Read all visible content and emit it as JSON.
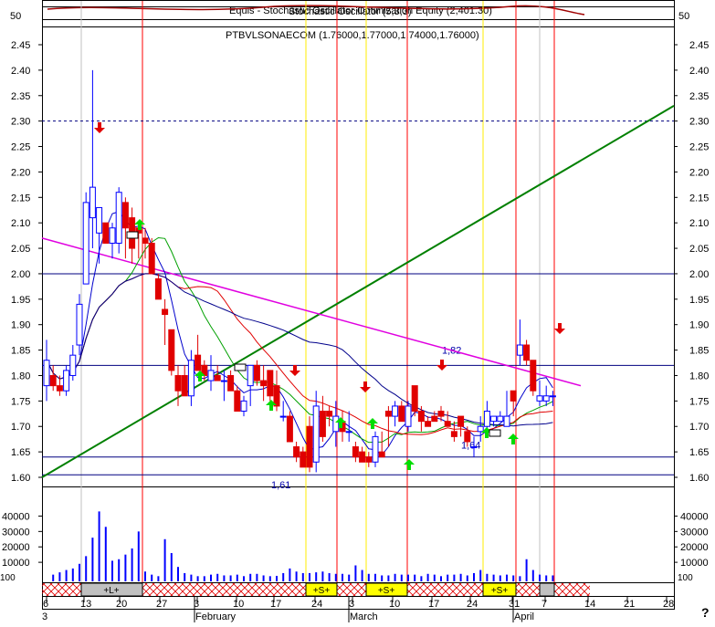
{
  "chart_data": {
    "type": "candlestick",
    "header": {
      "title": "Equis - Stochastic Oscillator Optimization Equity (2,401.30)",
      "overlap_text": "Stochastic Oscillator (5,3,3)",
      "subtitle": "PTBVLSONAECOM (1.76000,1.77000,1.74000,1.76000)",
      "tick_left": "50",
      "tick_right": "50"
    },
    "price_axis": {
      "ylim": [
        1.6,
        2.45
      ],
      "ticks": [
        "1.60",
        "1.65",
        "1.70",
        "1.75",
        "1.80",
        "1.85",
        "1.90",
        "1.95",
        "2.00",
        "2.05",
        "2.10",
        "2.15",
        "2.20",
        "2.25",
        "2.30",
        "2.35",
        "2.40",
        "2.45"
      ]
    },
    "volume_axis": {
      "ylim": [
        0,
        45000
      ],
      "ticks": [
        "10000",
        "20000",
        "30000",
        "40000"
      ],
      "bottom_label": "100"
    },
    "x_axis": {
      "ticks": [
        "6",
        "13",
        "20",
        "27",
        "3",
        "10",
        "17",
        "24",
        "3",
        "10",
        "17",
        "24",
        "31",
        "7",
        "14",
        "21",
        "28"
      ],
      "months": [
        "February",
        "March",
        "April"
      ],
      "first_label": "3"
    },
    "candles": [
      {
        "o": 1.78,
        "h": 1.87,
        "l": 1.75,
        "c": 1.83
      },
      {
        "o": 1.8,
        "h": 1.82,
        "l": 1.77,
        "c": 1.78
      },
      {
        "o": 1.78,
        "h": 1.8,
        "l": 1.76,
        "c": 1.77
      },
      {
        "o": 1.77,
        "h": 1.82,
        "l": 1.76,
        "c": 1.81
      },
      {
        "o": 1.8,
        "h": 1.86,
        "l": 1.79,
        "c": 1.84
      },
      {
        "o": 1.86,
        "h": 1.96,
        "l": 1.84,
        "c": 1.94
      },
      {
        "o": 1.98,
        "h": 2.16,
        "l": 1.98,
        "c": 2.14
      },
      {
        "o": 2.11,
        "h": 2.4,
        "l": 2.05,
        "c": 2.17
      },
      {
        "o": 2.08,
        "h": 2.1,
        "l": 2.02,
        "c": 2.13
      },
      {
        "o": 2.1,
        "h": 2.1,
        "l": 2.06,
        "c": 2.06
      },
      {
        "o": 2.06,
        "h": 2.1,
        "l": 2.03,
        "c": 2.09
      },
      {
        "o": 2.06,
        "h": 2.17,
        "l": 2.04,
        "c": 2.16
      },
      {
        "o": 2.14,
        "h": 2.15,
        "l": 2.03,
        "c": 2.09
      },
      {
        "o": 2.11,
        "h": 2.13,
        "l": 2.02,
        "c": 2.05
      },
      {
        "o": 2.09,
        "h": 2.1,
        "l": 2.03,
        "c": 2.08
      },
      {
        "o": 2.07,
        "h": 2.09,
        "l": 2.03,
        "c": 2.06
      },
      {
        "o": 2.06,
        "h": 2.07,
        "l": 2.0,
        "c": 2.0
      },
      {
        "o": 1.99,
        "h": 2.0,
        "l": 1.95,
        "c": 1.95
      },
      {
        "o": 1.93,
        "h": 1.95,
        "l": 1.86,
        "c": 1.92
      },
      {
        "o": 1.89,
        "h": 1.89,
        "l": 1.8,
        "c": 1.81
      },
      {
        "o": 1.8,
        "h": 1.82,
        "l": 1.74,
        "c": 1.77
      },
      {
        "o": 1.8,
        "h": 1.82,
        "l": 1.76,
        "c": 1.76
      },
      {
        "o": 1.76,
        "h": 1.85,
        "l": 1.74,
        "c": 1.83
      },
      {
        "o": 1.84,
        "h": 1.88,
        "l": 1.81,
        "c": 1.81
      },
      {
        "o": 1.82,
        "h": 1.83,
        "l": 1.79,
        "c": 1.8
      },
      {
        "o": 1.79,
        "h": 1.84,
        "l": 1.77,
        "c": 1.81
      },
      {
        "o": 1.8,
        "h": 1.82,
        "l": 1.79,
        "c": 1.79
      },
      {
        "o": 1.79,
        "h": 1.81,
        "l": 1.75,
        "c": 1.79
      },
      {
        "o": 1.8,
        "h": 1.81,
        "l": 1.77,
        "c": 1.77
      },
      {
        "o": 1.77,
        "h": 1.78,
        "l": 1.73,
        "c": 1.73
      },
      {
        "o": 1.73,
        "h": 1.76,
        "l": 1.72,
        "c": 1.75
      },
      {
        "o": 1.78,
        "h": 1.82,
        "l": 1.74,
        "c": 1.82
      },
      {
        "o": 1.82,
        "h": 1.83,
        "l": 1.78,
        "c": 1.79
      },
      {
        "o": 1.79,
        "h": 1.82,
        "l": 1.75,
        "c": 1.78
      },
      {
        "o": 1.81,
        "h": 1.81,
        "l": 1.75,
        "c": 1.76
      },
      {
        "o": 1.78,
        "h": 1.81,
        "l": 1.73,
        "c": 1.74
      },
      {
        "o": 1.72,
        "h": 1.75,
        "l": 1.71,
        "c": 1.72
      },
      {
        "o": 1.72,
        "h": 1.73,
        "l": 1.67,
        "c": 1.67
      },
      {
        "o": 1.66,
        "h": 1.67,
        "l": 1.63,
        "c": 1.64
      },
      {
        "o": 1.65,
        "h": 1.66,
        "l": 1.62,
        "c": 1.62
      },
      {
        "o": 1.7,
        "h": 1.72,
        "l": 1.61,
        "c": 1.62
      },
      {
        "o": 1.63,
        "h": 1.77,
        "l": 1.61,
        "c": 1.74
      },
      {
        "o": 1.73,
        "h": 1.76,
        "l": 1.67,
        "c": 1.68
      },
      {
        "o": 1.73,
        "h": 1.74,
        "l": 1.7,
        "c": 1.72
      },
      {
        "o": 1.69,
        "h": 1.75,
        "l": 1.66,
        "c": 1.72
      },
      {
        "o": 1.71,
        "h": 1.73,
        "l": 1.67,
        "c": 1.69
      },
      {
        "o": 1.69,
        "h": 1.73,
        "l": 1.67,
        "c": 1.69
      },
      {
        "o": 1.66,
        "h": 1.67,
        "l": 1.63,
        "c": 1.64
      },
      {
        "o": 1.65,
        "h": 1.66,
        "l": 1.63,
        "c": 1.63
      },
      {
        "o": 1.64,
        "h": 1.65,
        "l": 1.62,
        "c": 1.63
      },
      {
        "o": 1.63,
        "h": 1.69,
        "l": 1.62,
        "c": 1.68
      },
      {
        "o": 1.65,
        "h": 1.69,
        "l": 1.64,
        "c": 1.64
      },
      {
        "o": 1.73,
        "h": 1.74,
        "l": 1.66,
        "c": 1.72
      },
      {
        "o": 1.72,
        "h": 1.75,
        "l": 1.7,
        "c": 1.74
      },
      {
        "o": 1.74,
        "h": 1.75,
        "l": 1.71,
        "c": 1.71
      },
      {
        "o": 1.7,
        "h": 1.75,
        "l": 1.69,
        "c": 1.74
      },
      {
        "o": 1.78,
        "h": 1.78,
        "l": 1.72,
        "c": 1.73
      },
      {
        "o": 1.73,
        "h": 1.74,
        "l": 1.69,
        "c": 1.71
      },
      {
        "o": 1.71,
        "h": 1.72,
        "l": 1.7,
        "c": 1.7
      },
      {
        "o": 1.72,
        "h": 1.73,
        "l": 1.71,
        "c": 1.71
      },
      {
        "o": 1.73,
        "h": 1.74,
        "l": 1.71,
        "c": 1.72
      },
      {
        "o": 1.71,
        "h": 1.73,
        "l": 1.7,
        "c": 1.7
      },
      {
        "o": 1.69,
        "h": 1.71,
        "l": 1.67,
        "c": 1.68
      },
      {
        "o": 1.72,
        "h": 1.72,
        "l": 1.68,
        "c": 1.7
      },
      {
        "o": 1.69,
        "h": 1.7,
        "l": 1.66,
        "c": 1.67
      },
      {
        "o": 1.66,
        "h": 1.68,
        "l": 1.64,
        "c": 1.66
      },
      {
        "o": 1.69,
        "h": 1.72,
        "l": 1.67,
        "c": 1.7
      },
      {
        "o": 1.7,
        "h": 1.75,
        "l": 1.69,
        "c": 1.73
      },
      {
        "o": 1.71,
        "h": 1.72,
        "l": 1.7,
        "c": 1.72
      },
      {
        "o": 1.71,
        "h": 1.73,
        "l": 1.71,
        "c": 1.72
      },
      {
        "o": 1.7,
        "h": 1.77,
        "l": 1.71,
        "c": 1.72
      },
      {
        "o": 1.77,
        "h": 1.77,
        "l": 1.72,
        "c": 1.75
      },
      {
        "o": 1.84,
        "h": 1.91,
        "l": 1.82,
        "c": 1.86
      },
      {
        "o": 1.86,
        "h": 1.87,
        "l": 1.82,
        "c": 1.83
      },
      {
        "o": 1.83,
        "h": 1.83,
        "l": 1.76,
        "c": 1.77
      },
      {
        "o": 1.75,
        "h": 1.79,
        "l": 1.74,
        "c": 1.76
      },
      {
        "o": 1.75,
        "h": 1.78,
        "l": 1.74,
        "c": 1.76
      },
      {
        "o": 1.76,
        "h": 1.77,
        "l": 1.74,
        "c": 1.76
      }
    ],
    "volumes": [
      0,
      2000,
      3500,
      5000,
      6000,
      9000,
      14000,
      26000,
      43000,
      33000,
      11000,
      12000,
      15000,
      19000,
      30000,
      4000,
      2000,
      1000,
      25000,
      16000,
      7000,
      3000,
      2000,
      1000,
      1000,
      2000,
      2500,
      1500,
      1500,
      2000,
      1000,
      2500,
      2500,
      1500,
      1000,
      1200,
      3000,
      6000,
      4000,
      3000,
      3000,
      3500,
      4000,
      3000,
      2500,
      2500,
      2000,
      8000,
      5000,
      2500,
      2500,
      1500,
      1500,
      2500,
      2000,
      2000,
      2000,
      1000,
      2500,
      2000,
      1000,
      2000,
      2000,
      2500,
      1500,
      3000,
      5000,
      2500,
      2000,
      1500,
      2000,
      1500,
      1000,
      12000,
      5000,
      2000,
      1500,
      1500
    ],
    "horizontal_lines": [
      {
        "value": 2.3,
        "style": "dashed"
      },
      {
        "value": 2.0,
        "style": "solid"
      },
      {
        "value": 1.82,
        "label": "1,82"
      },
      {
        "value": 1.64,
        "label": "1,64"
      },
      {
        "value": 1.605,
        "label": "1,61"
      }
    ],
    "trend_lines": [
      {
        "color": "#008000",
        "from": [
          0,
          1.6
        ],
        "to": [
          null,
          2.33
        ]
      },
      {
        "color": "#e000e0",
        "from": [
          0,
          2.07
        ],
        "to": [
          null,
          1.78
        ]
      }
    ],
    "buy_arrows": [
      10,
      35,
      40,
      47,
      58,
      65,
      67,
      69,
      72,
      76
    ],
    "sell_arrows": [
      6,
      32,
      48,
      53,
      58,
      72,
      77,
      90
    ],
    "flag_labels": [
      "+L+",
      "+S+",
      "+S+",
      "+S+"
    ],
    "colors": {
      "up": "#0000ff",
      "down": "#e00000",
      "ma_fast": "#00a000",
      "ma_mid": "#e00000",
      "ma_long": "#00008b",
      "stoch": "#a00000"
    }
  }
}
